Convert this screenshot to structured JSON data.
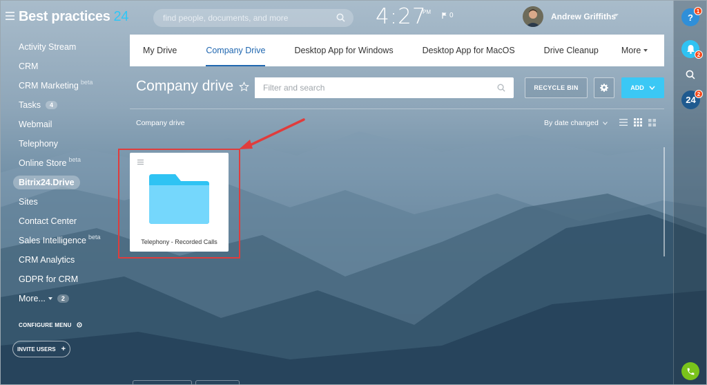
{
  "header": {
    "logo_text": "Best practices",
    "logo_num": "24",
    "search_placeholder": "find people, documents, and more",
    "time": "4:27",
    "ampm": "PM",
    "flag_count": "0",
    "user_name": "Andrew Griffiths"
  },
  "sidebar": {
    "items": [
      {
        "label": "Activity Stream"
      },
      {
        "label": "CRM"
      },
      {
        "label": "CRM Marketing",
        "beta": "beta"
      },
      {
        "label": "Tasks",
        "count": "4"
      },
      {
        "label": "Webmail"
      },
      {
        "label": "Telephony"
      },
      {
        "label": "Online Store",
        "beta": "beta"
      },
      {
        "label": "Bitrix24.Drive",
        "active": true
      },
      {
        "label": "Sites"
      },
      {
        "label": "Contact Center"
      },
      {
        "label": "Sales Intelligence",
        "beta": "beta"
      },
      {
        "label": "CRM Analytics"
      },
      {
        "label": "GDPR for CRM"
      },
      {
        "label": "More...",
        "count": "2"
      }
    ],
    "configure_menu": "CONFIGURE MENU",
    "invite_users": "INVITE USERS"
  },
  "tabs": [
    {
      "label": "My Drive"
    },
    {
      "label": "Company Drive",
      "active": true
    },
    {
      "label": "Desktop App for Windows"
    },
    {
      "label": "Desktop App for MacOS"
    },
    {
      "label": "Drive Cleanup"
    },
    {
      "label": "More"
    }
  ],
  "toolbar": {
    "page_title": "Company drive",
    "filter_placeholder": "Filter and search",
    "recycle_bin": "RECYCLE BIN",
    "add": "ADD"
  },
  "content": {
    "breadcrumb": "Company drive",
    "sort_label": "By date changed",
    "folder_name": "Telephony - Recorded Calls"
  },
  "right_bar": {
    "help_badge": "1",
    "notify_badge": "2",
    "b24_label": "24",
    "b24_badge": "2"
  },
  "colors": {
    "accent": "#2067b0",
    "add_button": "#3bc8f5",
    "folder": "#75d7fc",
    "highlight": "#e03c3c",
    "badge": "#f54819"
  }
}
